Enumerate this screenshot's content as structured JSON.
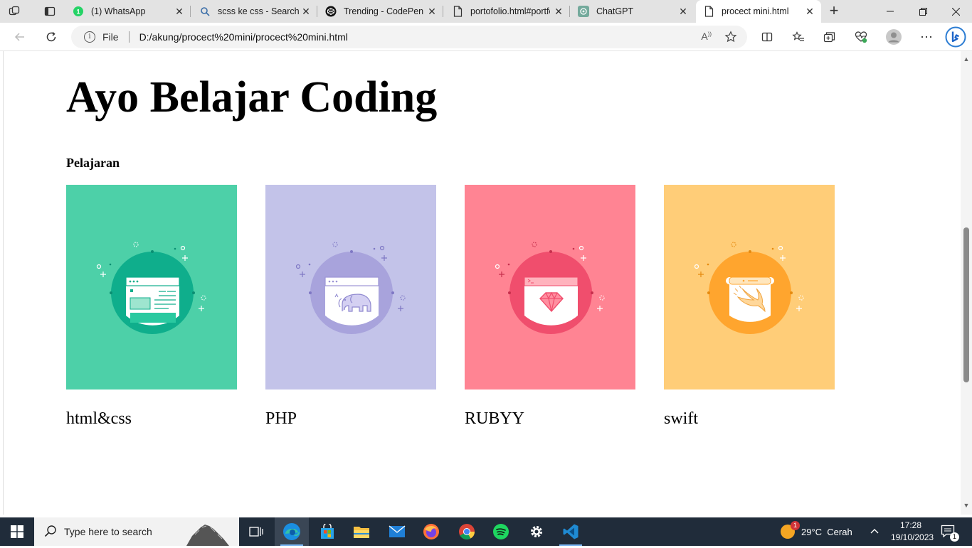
{
  "browser": {
    "tabs": [
      {
        "label": "(1) WhatsApp",
        "icon": "whatsapp-icon",
        "badge": "1"
      },
      {
        "label": "scss ke css - Search",
        "icon": "search-icon"
      },
      {
        "label": "Trending - CodePen",
        "icon": "codepen-icon"
      },
      {
        "label": "portofolio.html#portfolio",
        "icon": "file-icon"
      },
      {
        "label": "ChatGPT",
        "icon": "chatgpt-icon"
      },
      {
        "label": "procect mini.html",
        "icon": "file-icon",
        "active": true
      }
    ],
    "address": {
      "scheme": "File",
      "url": "D:/akung/procect%20mini/procect%20mini.html"
    }
  },
  "page": {
    "title": "Ayo Belajar Coding",
    "section": "Pelajaran",
    "cards": [
      {
        "label": "html&css",
        "bg": "#4dd0a8",
        "circle": "#0fae8c",
        "accent": "#14b394",
        "icon": "html-window-icon"
      },
      {
        "label": "PHP",
        "bg": "#c3c3e9",
        "circle": "#a8a3dc",
        "accent": "#9c94d6",
        "icon": "php-elephant-icon"
      },
      {
        "label": "RUBYY",
        "bg": "#ff8493",
        "circle": "#f04e6d",
        "accent": "#f04e6d",
        "icon": "ruby-gem-icon"
      },
      {
        "label": "swift",
        "bg": "#ffcd78",
        "circle": "#ffa52e",
        "accent": "#ff9f1a",
        "icon": "swift-bird-icon"
      }
    ]
  },
  "taskbar": {
    "search_placeholder": "Type here to search",
    "weather": "29°C  Cerah",
    "weather_badge": "1",
    "time": "17:28",
    "date": "19/10/2023",
    "notification_count": "1"
  }
}
